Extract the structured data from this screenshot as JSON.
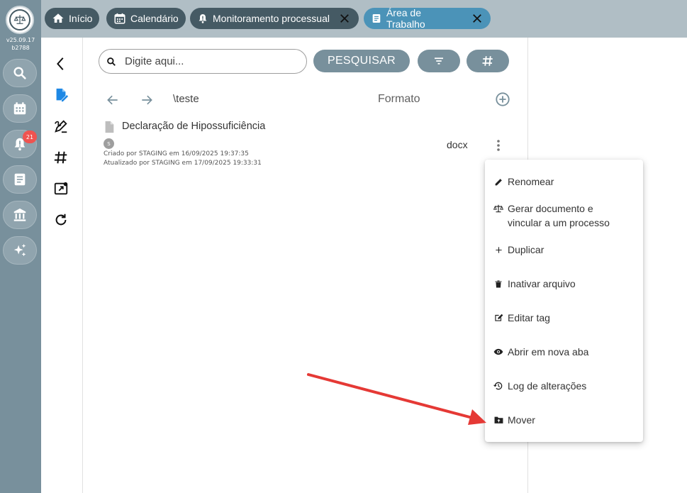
{
  "version": {
    "line1": "v25.09.17",
    "line2": "b2788"
  },
  "rail": {
    "items": [
      "search-icon",
      "calendar-icon",
      "bell-icon",
      "document-icon",
      "bank-icon",
      "sparkles-icon"
    ],
    "badge": "21"
  },
  "tabs": [
    {
      "label": "Início",
      "icon": "home-icon"
    },
    {
      "label": "Calendário",
      "icon": "calendar-icon"
    },
    {
      "label": "Monitoramento processual",
      "icon": "bell-icon",
      "closable": true
    },
    {
      "label": "Área de Trabalho",
      "icon": "document-icon",
      "closable": true,
      "active": true
    }
  ],
  "sidebar2": {
    "items": [
      "chevron-left-icon",
      "edit-document-icon",
      "draw-icon",
      "hash-icon",
      "open-external-icon",
      "refresh-icon"
    ]
  },
  "search": {
    "placeholder": "Digite aqui...",
    "button": "PESQUISAR"
  },
  "nav": {
    "path": "\\teste",
    "format_header": "Formato"
  },
  "file": {
    "name": "Declaração de Hipossuficiência",
    "avatar": "S",
    "created": "Criado por STAGING em 16/09/2025 19:37:35",
    "updated": "Atualizado por STAGING em 17/09/2025 19:33:31",
    "format": "docx"
  },
  "menu": {
    "items": [
      {
        "label": "Renomear",
        "icon": "pencil-icon"
      },
      {
        "label": "Gerar documento e",
        "label2": "vincular a um processo",
        "icon": "scale-icon"
      },
      {
        "label": "Duplicar",
        "icon": "plus-icon"
      },
      {
        "label": "Inativar arquivo",
        "icon": "trash-icon"
      },
      {
        "label": "Editar tag",
        "icon": "edit-square-icon"
      },
      {
        "label": "Abrir em nova aba",
        "icon": "eye-icon"
      },
      {
        "label": "Log de alterações",
        "icon": "history-icon"
      },
      {
        "label": "Mover",
        "icon": "move-folder-icon"
      }
    ]
  },
  "colors": {
    "rail": "#78909c",
    "topbar": "#b0bec5",
    "tab": "#455a64",
    "tab_active": "#4b93b8",
    "accent_blue": "#1e88e5",
    "badge": "#ef5350",
    "annotation_arrow": "#e53935"
  }
}
